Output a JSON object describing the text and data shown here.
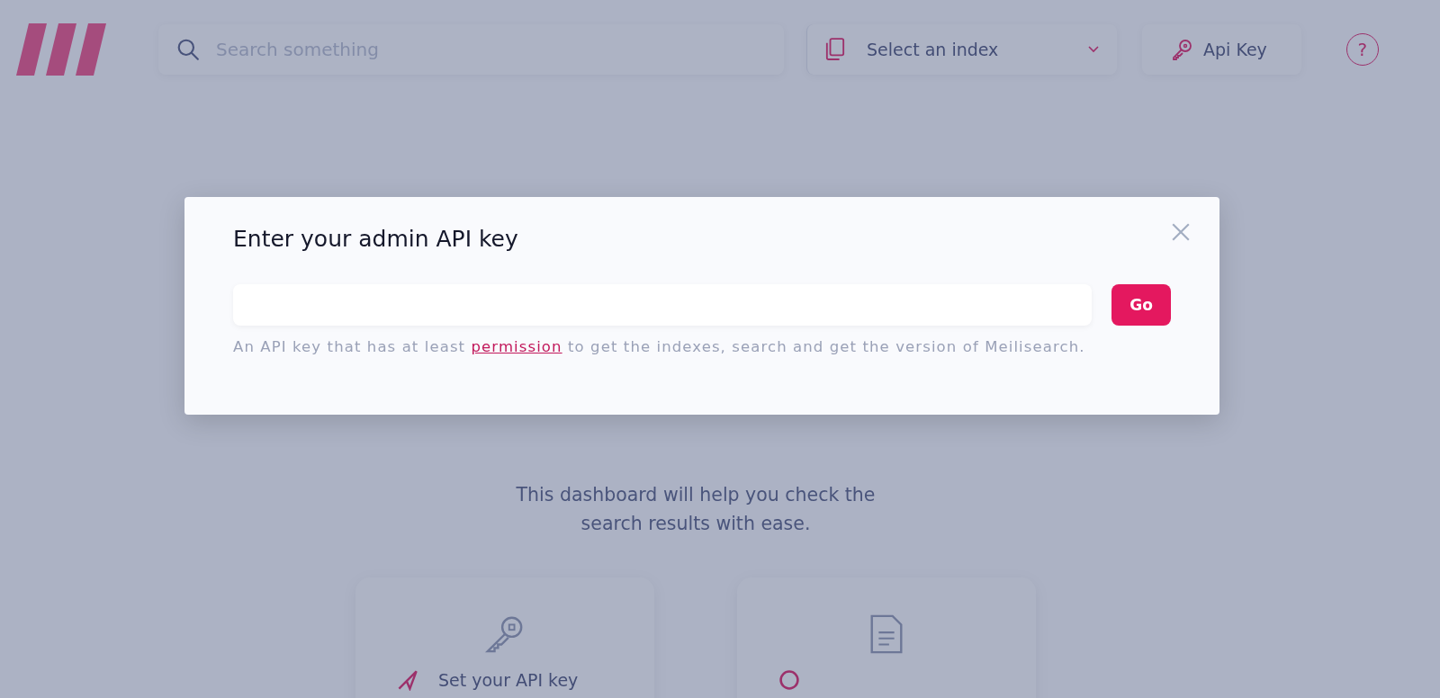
{
  "header": {
    "search": {
      "placeholder": "Search something"
    },
    "index_select": {
      "label": "Select an index"
    },
    "api_key_button": {
      "label": "Api Key"
    },
    "help_button": {
      "label": "?"
    }
  },
  "welcome": {
    "subtitle": "This dashboard will help you check the search results with ease."
  },
  "cards": [
    {
      "title": "Set your API key"
    }
  ],
  "modal": {
    "title": "Enter your admin API key",
    "go_button": "Go",
    "help": {
      "before": "An API key that has at least",
      "link": "permission",
      "after": "to get the indexes, search and get the version of Meilisearch."
    }
  }
}
